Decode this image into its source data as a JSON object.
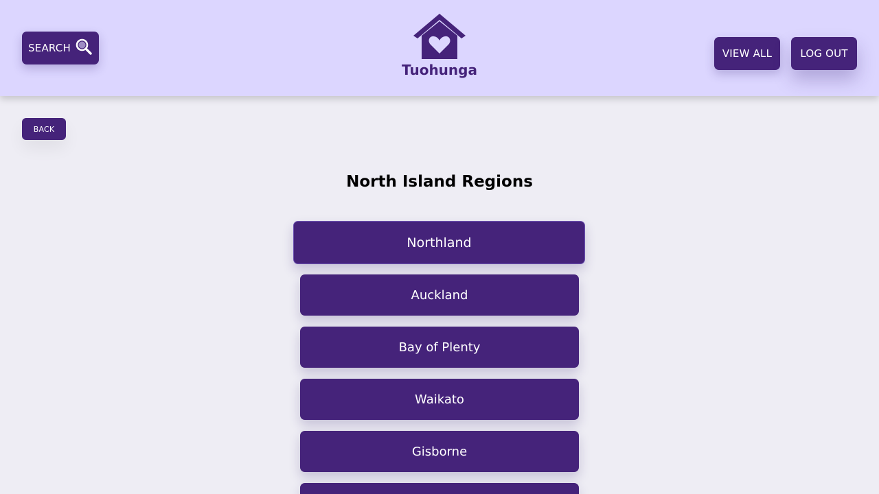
{
  "header": {
    "search_label": "SEARCH",
    "search_icon": "search-icon",
    "logo_icon": "house-heart-icon",
    "logo_text": "Tuohunga",
    "view_all_label": "VIEW ALL",
    "log_out_label": "LOG OUT"
  },
  "back_label": "BACK",
  "page_title": "North Island Regions",
  "regions": [
    {
      "label": "Northland",
      "active": true
    },
    {
      "label": "Auckland"
    },
    {
      "label": "Bay of Plenty"
    },
    {
      "label": "Waikato"
    },
    {
      "label": "Gisborne"
    },
    {
      "label": ""
    }
  ],
  "colors": {
    "header_bg": "#dcd6ff",
    "button_bg": "#45237a",
    "page_bg": "#eeedf4"
  }
}
